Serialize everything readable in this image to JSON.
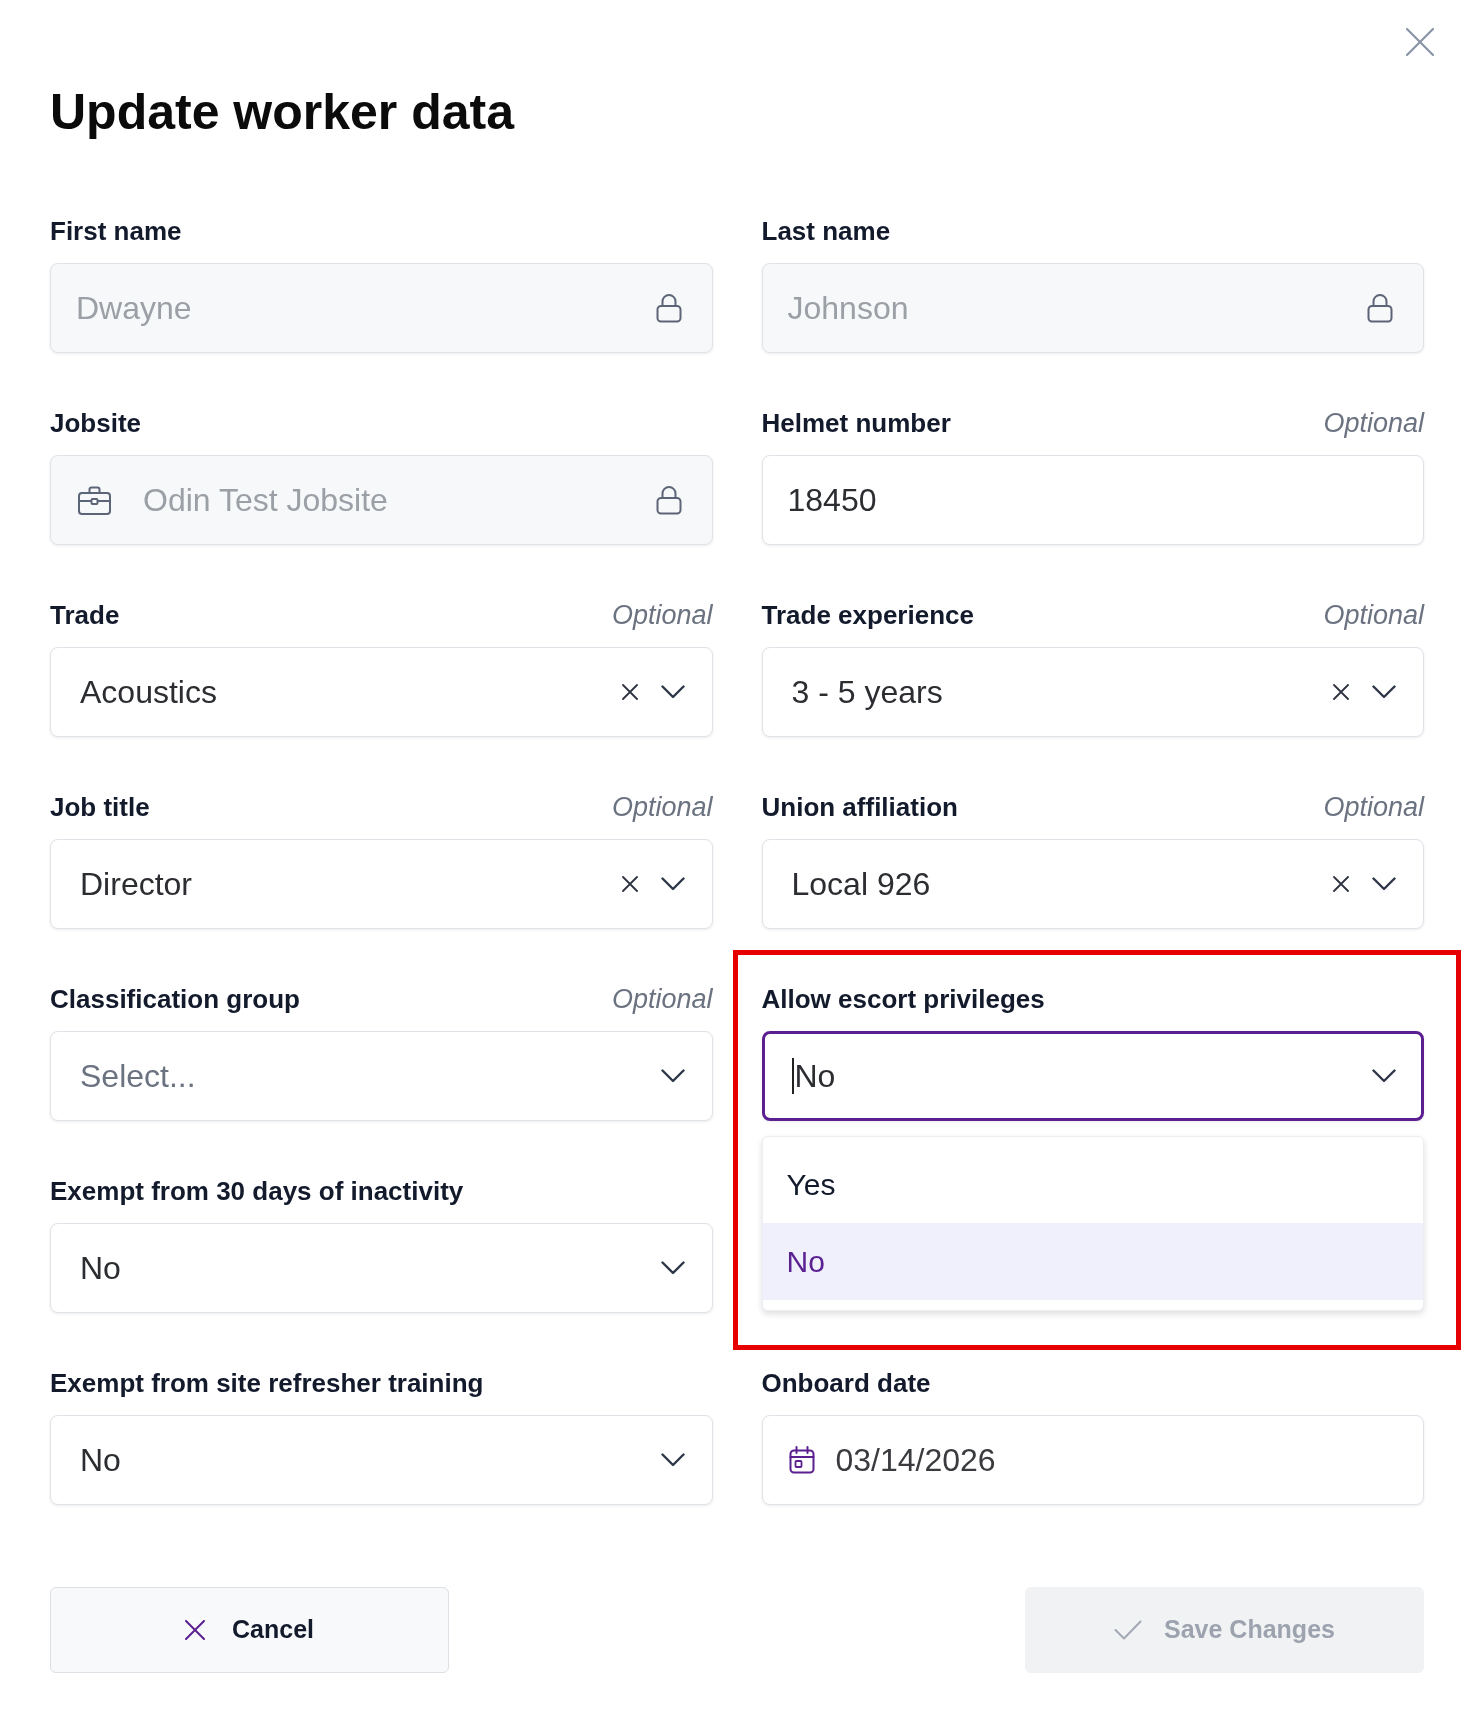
{
  "dialog": {
    "title": "Update worker data"
  },
  "rows": [
    [
      {
        "label": "First name",
        "kind": "text",
        "locked": true,
        "value": "Dwayne"
      },
      {
        "label": "Last name",
        "kind": "text",
        "locked": true,
        "value": "Johnson"
      }
    ],
    [
      {
        "label": "Jobsite",
        "kind": "site",
        "locked": true,
        "value": "Odin Test Jobsite"
      },
      {
        "label": "Helmet number",
        "hint": "Optional",
        "kind": "text",
        "locked": false,
        "value": "18450"
      }
    ],
    [
      {
        "label": "Trade",
        "hint": "Optional",
        "kind": "select",
        "clearable": true,
        "value": "Acoustics"
      },
      {
        "label": "Trade experience",
        "hint": "Optional",
        "kind": "select",
        "clearable": true,
        "value": "3 - 5 years"
      }
    ],
    [
      {
        "label": "Job title",
        "hint": "Optional",
        "kind": "select",
        "clearable": true,
        "value": "Director"
      },
      {
        "label": "Union affiliation",
        "hint": "Optional",
        "kind": "select",
        "clearable": true,
        "value": "Local 926"
      }
    ],
    [
      {
        "label": "Classification group",
        "hint": "Optional",
        "kind": "select",
        "clearable": false,
        "placeholder": "Select..."
      },
      {
        "label": "Allow escort privileges",
        "kind": "select",
        "clearable": false,
        "value": "No",
        "focused": true,
        "expanded": true,
        "highlighted": true,
        "options": [
          {
            "label": "Yes",
            "selected": false
          },
          {
            "label": "No",
            "selected": true
          }
        ]
      }
    ],
    [
      {
        "label": "Exempt from 30 days of inactivity",
        "kind": "select",
        "clearable": false,
        "value": "No"
      }
    ],
    [
      {
        "label": "Exempt from site refresher training",
        "kind": "select",
        "clearable": false,
        "value": "No"
      },
      {
        "label": "Onboard date",
        "kind": "date",
        "value": "03/14/2026"
      }
    ]
  ],
  "buttons": [
    {
      "label": "Cancel",
      "kind": "cancel",
      "disabled": false
    },
    {
      "label": "Save Changes",
      "kind": "save",
      "disabled": true
    }
  ]
}
